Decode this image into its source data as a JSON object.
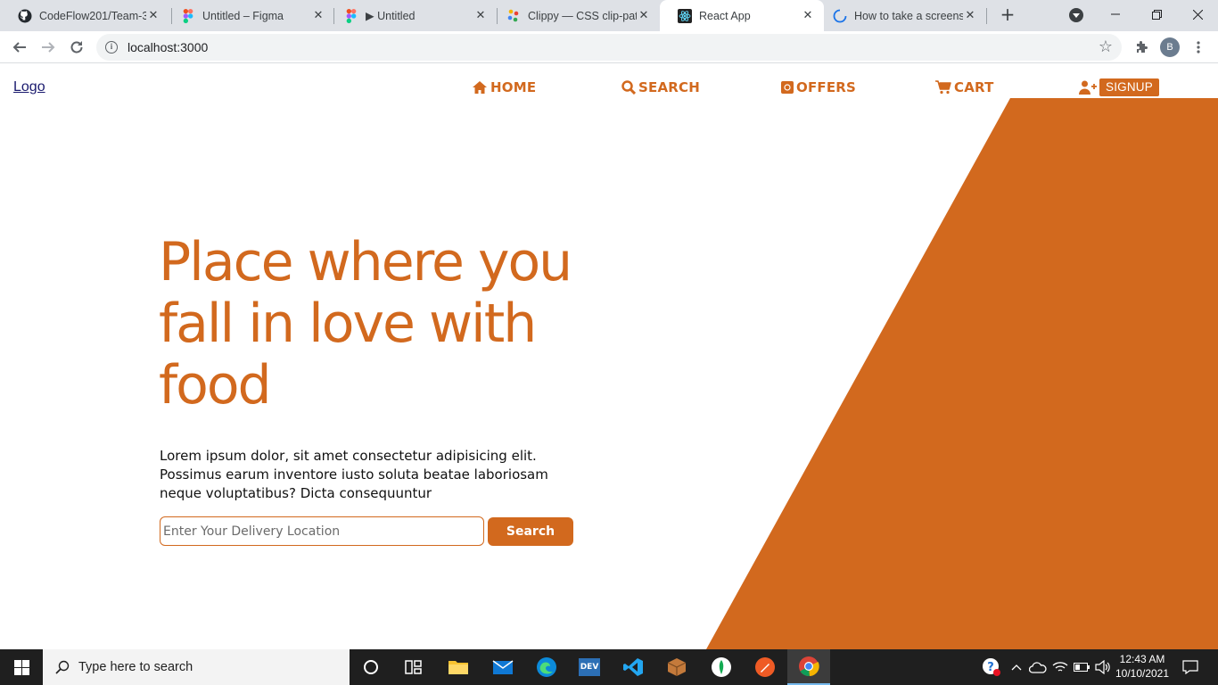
{
  "browser": {
    "tabs": [
      {
        "title": "CodeFlow201/Team-3",
        "icon": "github-icon"
      },
      {
        "title": "Untitled – Figma",
        "icon": "figma-icon"
      },
      {
        "title": "▶ Untitled",
        "icon": "figma-icon"
      },
      {
        "title": "Clippy — CSS clip-path",
        "icon": "clippy-icon"
      },
      {
        "title": "React App",
        "icon": "react-icon"
      },
      {
        "title": "How to take a screenshot",
        "icon": "loading-icon"
      }
    ],
    "active_tab_index": 4,
    "url": "localhost:3000",
    "profile_initial": "B",
    "close_glyph": "✕",
    "new_tab_glyph": "+"
  },
  "page": {
    "logo": "Logo",
    "nav": {
      "home": "HOME",
      "search": "SEARCH",
      "offers": "OFFERS",
      "cart": "CART",
      "signup": "SIGNUP"
    },
    "hero": {
      "title": "Place where you fall in love with food",
      "text": "Lorem ipsum dolor, sit amet consectetur adipisicing elit. Possimus earum inventore iusto soluta beatae laboriosam neque voluptatibus? Dicta consequuntur",
      "input_placeholder": "Enter Your Delivery Location",
      "button": "Search"
    }
  },
  "taskbar": {
    "search_placeholder": "Type here to search",
    "time": "12:43 AM",
    "date": "10/10/2021"
  },
  "colors": {
    "accent": "#d2691e"
  }
}
